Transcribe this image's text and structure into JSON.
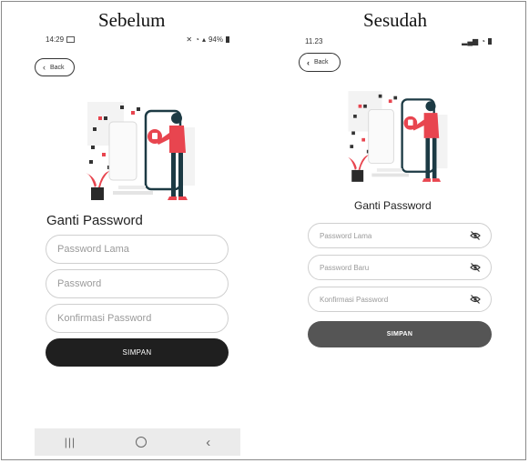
{
  "captions": {
    "before": "Sebelum",
    "after": "Sesudah"
  },
  "before": {
    "status": {
      "time": "14:29",
      "battery": "94%"
    },
    "back_label": "Back",
    "title": "Ganti Password",
    "fields": [
      {
        "placeholder": "Password Lama"
      },
      {
        "placeholder": "Password"
      },
      {
        "placeholder": "Konfirmasi Password"
      }
    ],
    "save_label": "SIMPAN"
  },
  "after": {
    "status": {
      "time": "11.23"
    },
    "back_label": "Back",
    "title": "Ganti Password",
    "fields": [
      {
        "placeholder": "Password Lama"
      },
      {
        "placeholder": "Password Baru"
      },
      {
        "placeholder": "Konfirmasi Password"
      }
    ],
    "save_label": "SIMPAN"
  },
  "colors": {
    "accent": "#e8454f",
    "dark_button": "#1f1f1f",
    "grey_button": "#555555",
    "figure": "#1c3a44"
  },
  "icons": {
    "hidden": "eye-off-icon",
    "back": "chevron-left-icon"
  }
}
